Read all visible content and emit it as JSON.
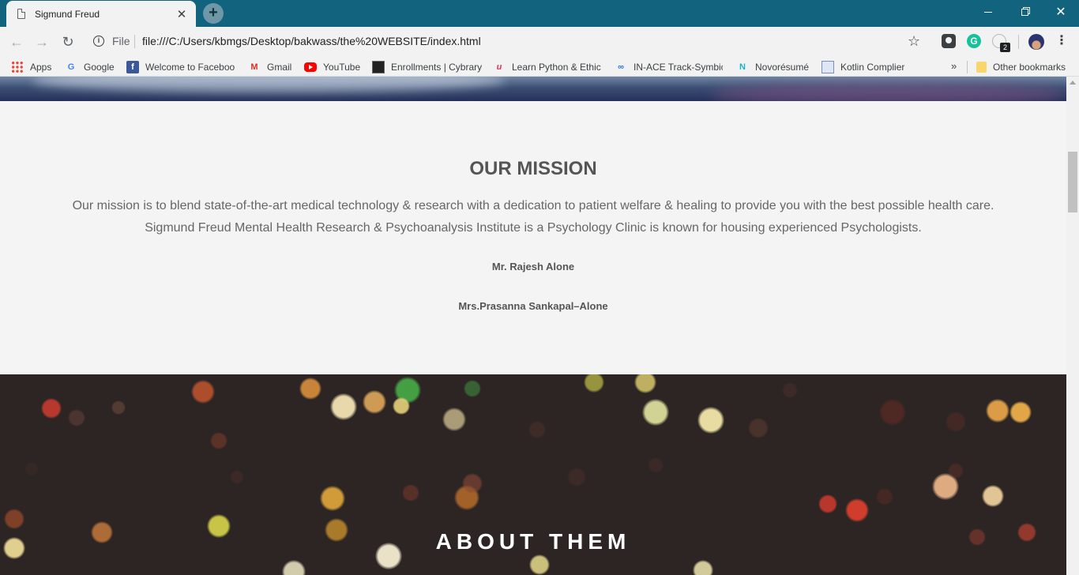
{
  "browser": {
    "tab_title": "Sigmund Freud",
    "tab_close": "✕",
    "new_tab": "+",
    "url_scheme": "File",
    "url": "file:///C:/Users/kbmgs/Desktop/bakwass/the%20WEBSITE/index.html",
    "extension_badge": "2",
    "grammarly_letter": "G"
  },
  "bookmarks": {
    "items": [
      {
        "label": "Apps",
        "icon": "apps-grid-icon"
      },
      {
        "label": "Google",
        "icon": "google-icon"
      },
      {
        "label": "Welcome to Faceboo",
        "icon": "facebook-icon"
      },
      {
        "label": "Gmail",
        "icon": "gmail-icon"
      },
      {
        "label": "YouTube",
        "icon": "youtube-icon"
      },
      {
        "label": "Enrollments | Cybrary",
        "icon": "cybrary-icon"
      },
      {
        "label": "Learn Python & Ethic",
        "icon": "learn-icon"
      },
      {
        "label": "IN-ACE Track-Symbic",
        "icon": "link-icon"
      },
      {
        "label": "Novorésumé",
        "icon": "novoresume-icon"
      },
      {
        "label": "Kotlin Complier",
        "icon": "kotlin-icon"
      }
    ],
    "more": "»",
    "other": "Other bookmarks"
  },
  "page": {
    "mission": {
      "title": "OUR MISSION",
      "line1": "Our mission is to blend state-of-the-art medical technology & research with a dedication to patient welfare & healing to provide you with the best possible health care.",
      "line2": "Sigmund Freud Mental Health Research & Psychoanalysis Institute is a Psychology Clinic is known for housing experienced Psychologists.",
      "signatory1": "Mr. Rajesh Alone",
      "signatory2": "Mrs.Prasanna Sankapal–Alone"
    },
    "about": {
      "title": "ABOUT THEM"
    }
  },
  "colors": {
    "titlebar": "#12637e",
    "heading": "#555555",
    "body_text": "#666666",
    "about_bg": "#2c2524"
  }
}
